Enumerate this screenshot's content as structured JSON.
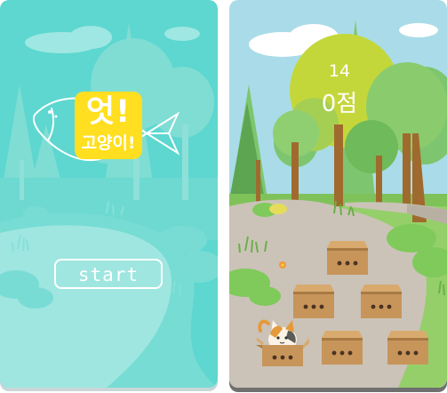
{
  "start_screen": {
    "title_line1": "엇!",
    "title_line2": "고양이!",
    "start_label": "start"
  },
  "game_screen": {
    "timer": "14",
    "score": "0점",
    "boxes": [
      {
        "row": 1,
        "col": 2,
        "has_cat": false
      },
      {
        "row": 2,
        "col": 1,
        "has_cat": false
      },
      {
        "row": 2,
        "col": 3,
        "has_cat": false
      },
      {
        "row": 3,
        "col": 1,
        "has_cat": true
      },
      {
        "row": 3,
        "col": 2,
        "has_cat": false
      },
      {
        "row": 3,
        "col": 3,
        "has_cat": false
      }
    ]
  },
  "colors": {
    "start_bg": "#5cd6cf",
    "title_yellow": "#ffdf1f",
    "box_brown": "#c7955a",
    "path": "#c9c1b6",
    "tree_green": "#6fb85a",
    "crown_yellow": "#bdd43a"
  }
}
